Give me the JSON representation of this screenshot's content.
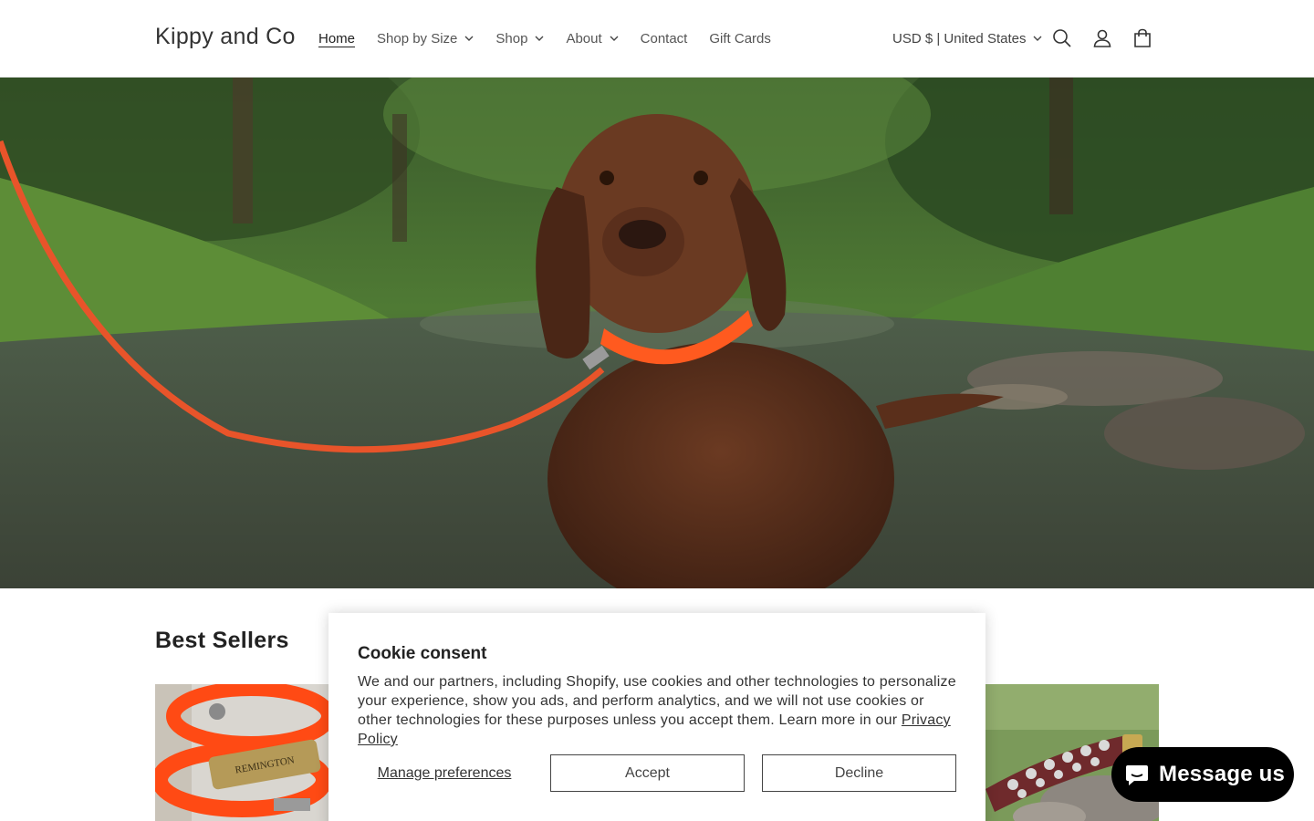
{
  "header": {
    "logo": "Kippy and Co",
    "nav": [
      {
        "label": "Home",
        "active": true,
        "dropdown": false
      },
      {
        "label": "Shop by Size",
        "active": false,
        "dropdown": true
      },
      {
        "label": "Shop",
        "active": false,
        "dropdown": true
      },
      {
        "label": "About",
        "active": false,
        "dropdown": true
      },
      {
        "label": "Contact",
        "active": false,
        "dropdown": false
      },
      {
        "label": "Gift Cards",
        "active": false,
        "dropdown": false
      }
    ],
    "currency": "USD $ | United States",
    "icons": [
      "search-icon",
      "account-icon",
      "cart-icon"
    ]
  },
  "hero": {
    "image": "chocolate-lab-dog-in-creek-with-orange-collar-and-leash"
  },
  "best_sellers": {
    "title": "Best Sellers",
    "products": [
      {
        "image": "orange-collar-with-brass-nameplate",
        "nameplate": "REMINGTON"
      },
      {
        "image": "studded-leather-collar-on-rocks"
      }
    ]
  },
  "cookie": {
    "title": "Cookie consent",
    "body": "We and our partners, including Shopify, use cookies and other technologies to personalize your experience, show you ads, and perform analytics, and we will not use cookies or other technologies for these purposes unless you accept them. Learn more in our ",
    "link": "Privacy Policy",
    "manage": "Manage preferences",
    "accept": "Accept",
    "decline": "Decline"
  },
  "chat": {
    "label": "Message us"
  },
  "colors": {
    "accent_orange": "#ff5a1f",
    "text": "#121212",
    "chat_bg": "#000000"
  }
}
